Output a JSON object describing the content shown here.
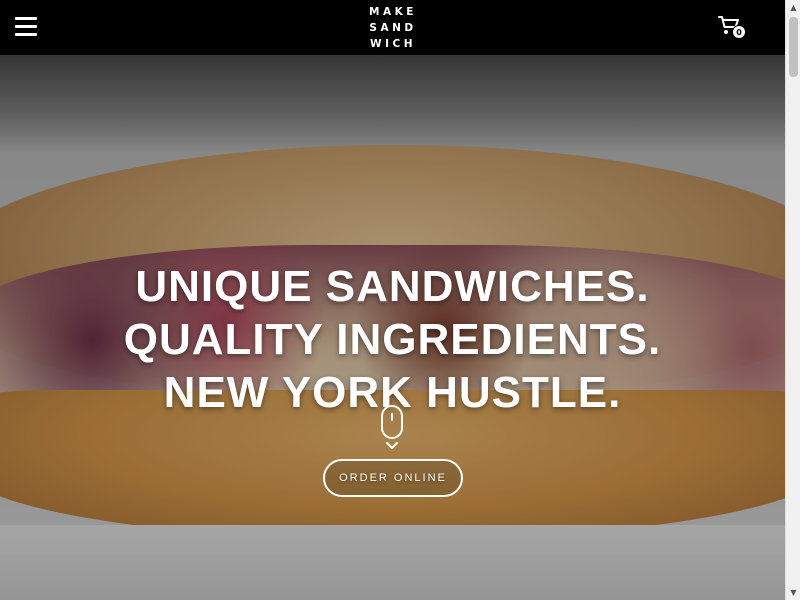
{
  "header": {
    "menu_icon": "hamburger-menu-icon",
    "logo_lines": [
      "MAKE",
      "SAND",
      "WICH"
    ],
    "cart_icon": "shopping-cart-icon",
    "cart_count": "0"
  },
  "hero": {
    "headline_lines": [
      "UNIQUE SANDWICHES.",
      "QUALITY INGREDIENTS.",
      "NEW YORK HUSTLE."
    ],
    "cta_label": "ORDER ONLINE",
    "scroll_icon": "mouse-scroll-icon",
    "chevron_icon": "chevron-down-icon"
  },
  "colors": {
    "topbar": "#000000",
    "text": "#ffffff"
  }
}
